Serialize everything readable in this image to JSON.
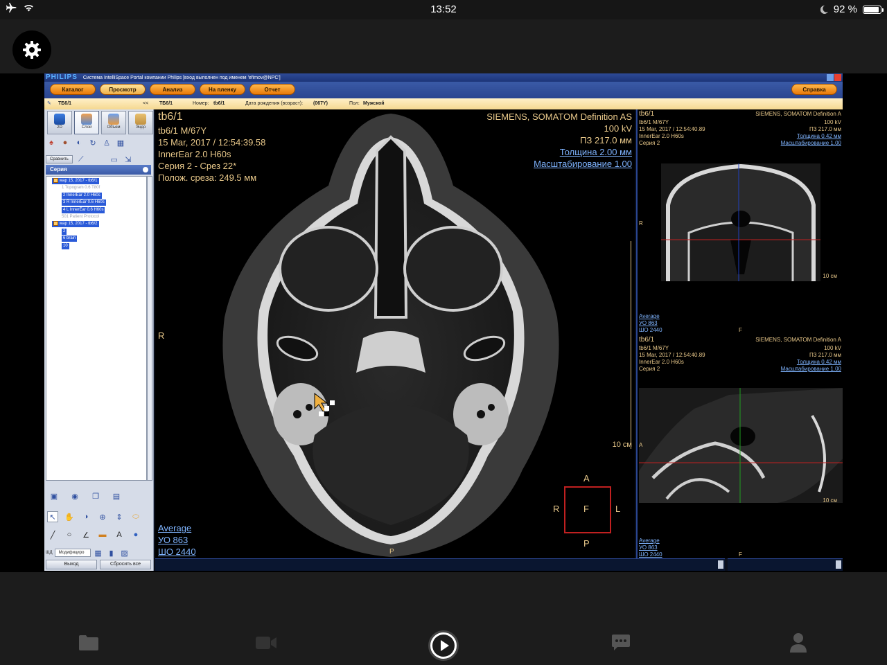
{
  "status_bar": {
    "time": "13:52",
    "battery_text": "92 %",
    "battery_level": 0.92,
    "icons": [
      "airplane-icon",
      "wifi-icon",
      "moon-icon",
      "battery-icon"
    ]
  },
  "app_header": {
    "settings_icon": "gear-icon"
  },
  "portal": {
    "brand": "PHILIPS",
    "window_title": "Система IntelliSpace Portal компании Philips [вход выполнен под именем 'efimov@NPC']",
    "menu": {
      "catalog": "Каталог",
      "view": "Просмотр",
      "analysis": "Анализ",
      "film": "На пленку",
      "report": "Отчет",
      "help": "Справка"
    },
    "infobar": {
      "patient_tab": "ТБ6/1",
      "collapse": "<<",
      "patient": "ТБ6/1",
      "number_label": "Номер:",
      "number_value": "tb6/1",
      "dob_label": "Дата рождения (возраст):",
      "dob_value": "(067Y)",
      "sex_label": "Пол:",
      "sex_value": "Мужской"
    },
    "left_panel": {
      "view_tabs": [
        "2D",
        "Слой",
        "Объем",
        "Эндо"
      ],
      "compare_button": "Сравнить",
      "series_header": "Серия",
      "tree": [
        {
          "text": "мар 15, 2017 - tb6/1",
          "level": 0,
          "highlight": true,
          "folder": true
        },
        {
          "text": "1  Topogram  0.6  T80f",
          "level": 1,
          "highlight": false,
          "dim": true
        },
        {
          "text": "2  InnerEar  2.0  H60s",
          "level": 1,
          "highlight": true
        },
        {
          "text": "3  R  InnerEar  0.6  H60s",
          "level": 1,
          "highlight": true
        },
        {
          "text": "4  L  InnerEar  0.6  H60s",
          "level": 1,
          "highlight": true
        },
        {
          "text": "501  Patient Protocol",
          "level": 1,
          "highlight": false,
          "dim": true
        },
        {
          "text": "мар 15, 2017 - tb6/2",
          "level": 0,
          "highlight": true,
          "folder": true
        },
        {
          "text": "2",
          "level": 1,
          "highlight": true
        },
        {
          "text": "6  brain",
          "level": 1,
          "highlight": true
        },
        {
          "text": "10",
          "level": 1,
          "highlight": true
        }
      ],
      "mode_label": "ШД",
      "mode_select": "Модифициро",
      "exit_button": "Выход",
      "reset_button": "Сбросить все"
    },
    "main_view": {
      "top_left": {
        "id": "tb6/1",
        "patient": "tb6/1 M/67Y",
        "datetime": "15 Mar, 2017 / 12:54:39.58",
        "protocol": "InnerEar  2.0  H60s",
        "series": "Серия 2 - Срез 22*",
        "position": "Полож. среза: 249.5 мм"
      },
      "top_right": {
        "scanner": "SIEMENS, SOMATOM Definition AS",
        "kv": "100 kV",
        "fov": "ПЗ 217.0 мм",
        "thickness": "Толщина 2.00 мм",
        "zoom": "Масштабирование 1.00"
      },
      "left_marker": "R",
      "scale": "10 см",
      "bottom_left": {
        "avg": "Average",
        "wl": "УО   863",
        "ww": "ШО  2440"
      },
      "orientation": {
        "top": "A",
        "left": "R",
        "center": "F",
        "right": "L",
        "bottom": "P"
      },
      "bottom_center": "P"
    },
    "side_top": {
      "id": "tb6/1",
      "patient": "tb6/1 M/67Y",
      "datetime": "15 Mar, 2017 / 12:54:40.89",
      "protocol": "InnerEar  2.0  H60s",
      "series": "Серия 2",
      "scanner": "SIEMENS, SOMATOM Definition A",
      "kv": "100 kV",
      "fov": "ПЗ 217.0 мм",
      "thickness": "Толщина 0.42 мм",
      "zoom": "Масштабирование 1.00",
      "marker_r": "R",
      "scale": "10 см",
      "avg": "Average",
      "wl": "УО   863",
      "ww": "ШО  2440",
      "bottom": "F"
    },
    "side_bottom": {
      "id": "tb6/1",
      "patient": "tb6/1 M/67Y",
      "datetime": "15 Mar, 2017 / 12:54:40.89",
      "protocol": "InnerEar  2.0  H60s",
      "series": "Серия 2",
      "scanner": "SIEMENS, SOMATOM Definition A",
      "kv": "100 kV",
      "fov": "ПЗ 217.0 мм",
      "thickness": "Толщина 0.42 мм",
      "zoom": "Масштабирование 1.00",
      "marker_a": "A",
      "scale": "10 см",
      "avg": "Average",
      "wl": "УО   863",
      "ww": "ШО  2440",
      "bottom": "F"
    }
  },
  "tab_bar": {
    "tabs": [
      "folder-icon",
      "video-icon",
      "play-icon",
      "chat-icon",
      "person-icon"
    ]
  },
  "colors": {
    "overlay_text": "#e8c88a",
    "overlay_link": "#7fb4ff",
    "menu_button": "#f09020",
    "title_blue": "#2a4590"
  }
}
